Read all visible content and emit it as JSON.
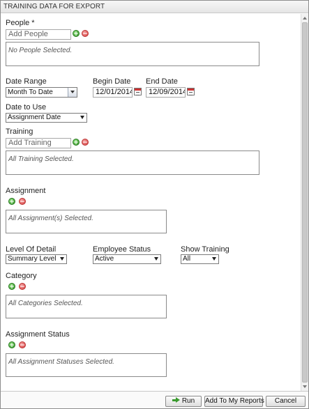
{
  "window": {
    "title": "TRAINING DATA FOR EXPORT"
  },
  "people": {
    "label": "People *",
    "input_placeholder": "Add People",
    "list_text": "No People Selected."
  },
  "date_range": {
    "label": "Date Range",
    "value": "Month To Date",
    "begin_label": "Begin Date",
    "begin_value": "12/01/2014",
    "end_label": "End Date",
    "end_value": "12/09/2014"
  },
  "date_to_use": {
    "label": "Date to Use",
    "value": "Assignment Date"
  },
  "training": {
    "label": "Training",
    "input_placeholder": "Add Training",
    "list_text": "All Training Selected."
  },
  "assignment": {
    "label": "Assignment",
    "list_text": "All Assignment(s) Selected."
  },
  "level_of_detail": {
    "label": "Level Of Detail",
    "value": "Summary Level"
  },
  "employee_status": {
    "label": "Employee Status",
    "value": "Active"
  },
  "show_training": {
    "label": "Show Training",
    "value": "All"
  },
  "category": {
    "label": "Category",
    "list_text": "All Categories Selected."
  },
  "assignment_status": {
    "label": "Assignment Status",
    "list_text": "All Assignment Statuses Selected."
  },
  "buttons": {
    "run": "Run",
    "add_to_reports": "Add To My Reports",
    "cancel": "Cancel"
  },
  "icons": {
    "add": "plus-circle-icon",
    "remove": "minus-circle-icon",
    "calendar": "calendar-icon",
    "run": "green-arrow-icon"
  }
}
